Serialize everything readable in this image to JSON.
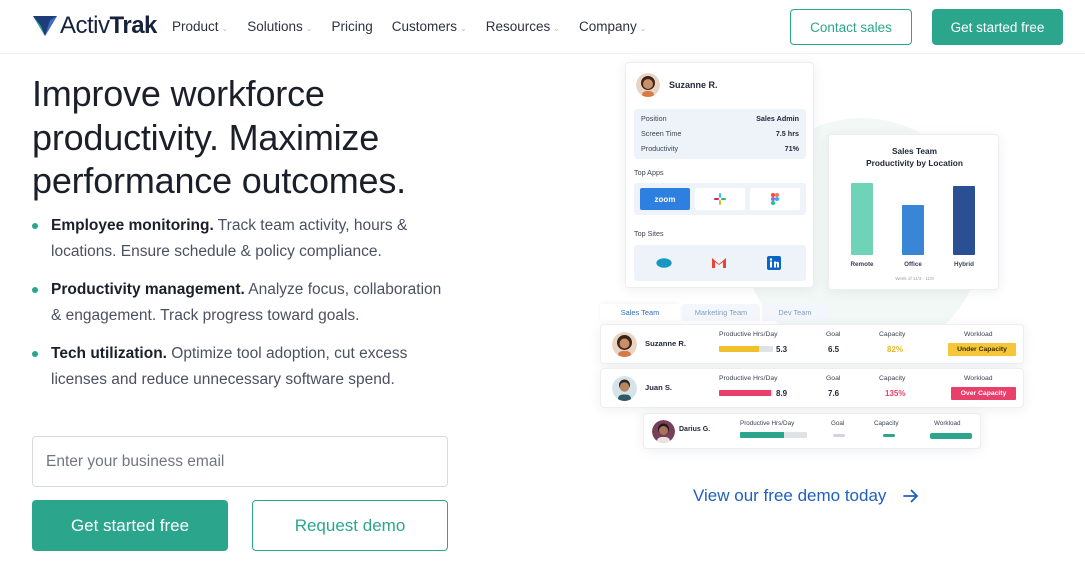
{
  "brand": {
    "name_light": "Activ",
    "name_bold": "Trak"
  },
  "nav": {
    "items": [
      {
        "label": "Product",
        "dropdown": true
      },
      {
        "label": "Solutions",
        "dropdown": true
      },
      {
        "label": "Pricing",
        "dropdown": false
      },
      {
        "label": "Customers",
        "dropdown": true
      },
      {
        "label": "Resources",
        "dropdown": true
      },
      {
        "label": "Company",
        "dropdown": true
      }
    ],
    "contact_label": "Contact sales",
    "get_started_label": "Get started free"
  },
  "hero": {
    "headline": "Improve workforce productivity. Maximize performance outcomes.",
    "features": [
      {
        "title": "Employee monitoring.",
        "text": " Track team activity, hours & locations. Ensure schedule & policy compliance."
      },
      {
        "title": "Productivity management.",
        "text": " Analyze focus, collaboration & engagement. Track progress toward goals."
      },
      {
        "title": "Tech utilization.",
        "text": " Optimize tool adoption, cut excess licenses and reduce unnecessary software spend."
      }
    ],
    "email_placeholder": "Enter your business email",
    "cta_primary": "Get started free",
    "cta_secondary": "Request demo"
  },
  "illustration": {
    "profile": {
      "name": "Suzanne R.",
      "stats": [
        {
          "label": "Position",
          "value": "Sales Admin"
        },
        {
          "label": "Screen Time",
          "value": "7.5 hrs"
        },
        {
          "label": "Productivity",
          "value": "71%"
        }
      ],
      "top_apps_label": "Top Apps",
      "apps": [
        "zoom",
        "slack-icon",
        "figma-icon"
      ],
      "top_sites_label": "Top Sites",
      "sites": [
        "salesforce-icon",
        "gmail-icon",
        "linkedin-icon"
      ]
    },
    "chart": {
      "title_line1": "Sales Team",
      "title_line2": "Productivity by Location",
      "note": "Week of 11/3 - 11/9",
      "bars": [
        {
          "label": "Remote",
          "value": 0.62,
          "color": "#6fd3b8"
        },
        {
          "label": "Office",
          "value": 0.43,
          "color": "#3a86d6"
        },
        {
          "label": "Hybrid",
          "value": 0.59,
          "color": "#2a4f93"
        }
      ]
    },
    "tabs": [
      "Sales Team",
      "Marketing Team",
      "Dev Team"
    ],
    "columns": {
      "hours": "Productive Hrs/Day",
      "goal": "Goal",
      "capacity": "Capacity",
      "workload": "Workload"
    },
    "rows": [
      {
        "name": "Suzanne R.",
        "hours": "5.3",
        "hours_fill": 0.74,
        "hours_color": "#f1c02d",
        "goal": "6.5",
        "capacity": "82%",
        "capacity_color": "#e9b82a",
        "workload": "Under Capacity",
        "workload_bg": "#f5c53a",
        "workload_color": "#3a2d00"
      },
      {
        "name": "Juan S.",
        "hours": "8.9",
        "hours_fill": 0.96,
        "hours_color": "#e83f6b",
        "goal": "7.6",
        "capacity": "135%",
        "capacity_color": "#e83f6b",
        "workload": "Over Capacity",
        "workload_bg": "#e83f6b",
        "workload_color": "#ffffff"
      },
      {
        "name": "Darius G.",
        "hours_fill": 0.66,
        "hours_color": "#2ca58d"
      }
    ]
  },
  "demo_link": "View our free demo today",
  "colors": {
    "accent": "#2ca58d",
    "link": "#1f5fbf",
    "ink": "#1a1f29"
  }
}
